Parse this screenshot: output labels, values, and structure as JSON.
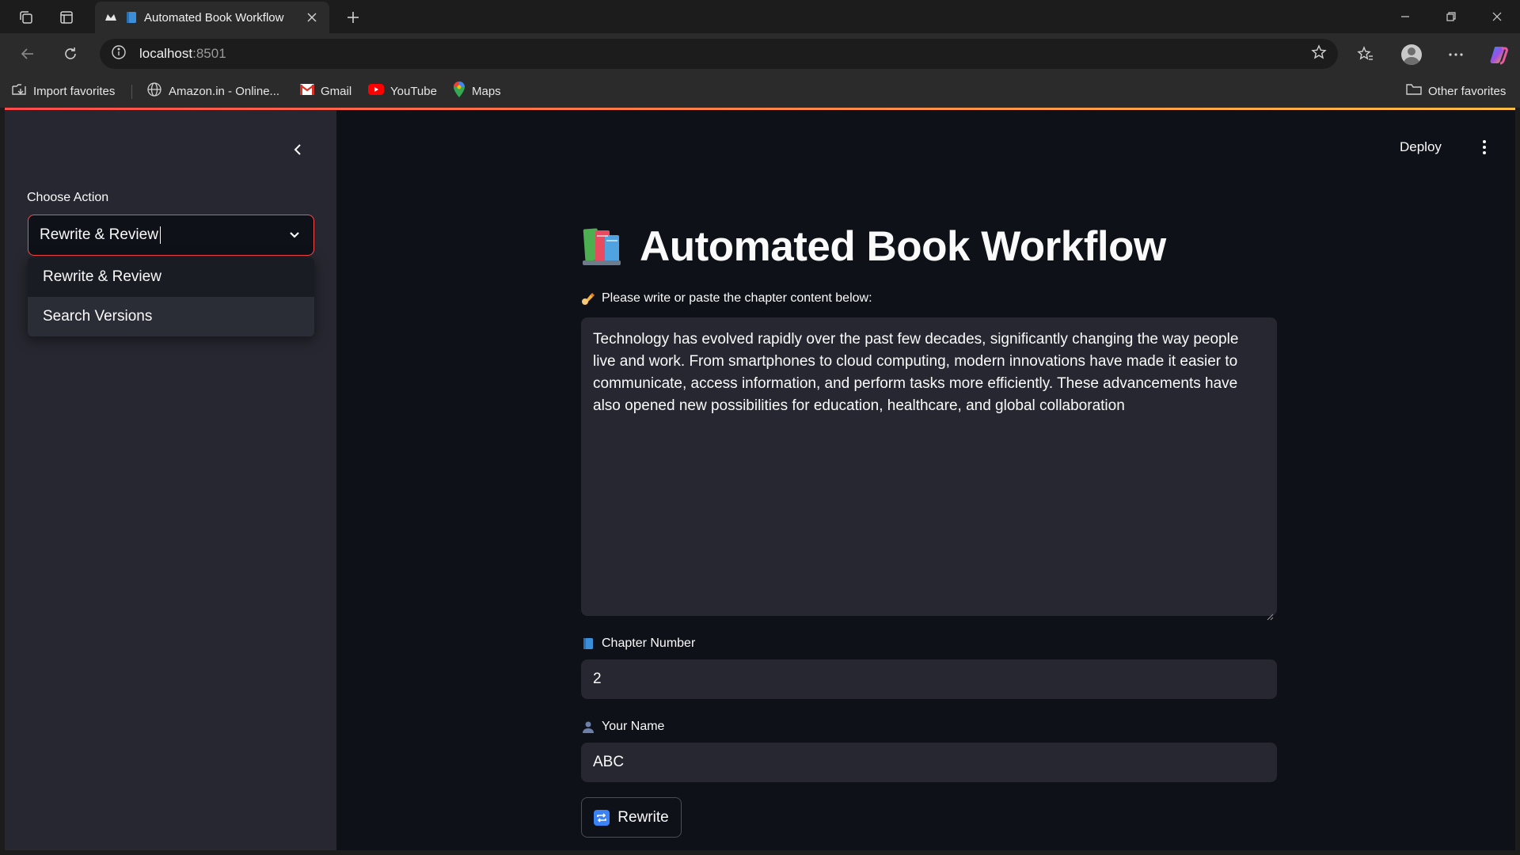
{
  "browser": {
    "tab": {
      "title": "Automated Book Workflow"
    },
    "address": {
      "host": "localhost",
      "port": ":8501"
    },
    "bookmarks": [
      {
        "label": "Import favorites",
        "icon": "import-icon"
      },
      {
        "label": "Amazon.in - Online...",
        "icon": "globe-icon"
      },
      {
        "label": "Gmail",
        "icon": "gmail-icon"
      },
      {
        "label": "YouTube",
        "icon": "youtube-icon"
      },
      {
        "label": "Maps",
        "icon": "maps-icon"
      }
    ],
    "other_favorites": "Other favorites"
  },
  "sidebar": {
    "label": "Choose Action",
    "selected": "Rewrite & Review",
    "options": [
      "Rewrite & Review",
      "Search Versions"
    ]
  },
  "header": {
    "deploy": "Deploy"
  },
  "main": {
    "title": "Automated Book Workflow",
    "content_label": "Please write or paste the chapter content below:",
    "content_value": "Technology has evolved rapidly over the past few decades, significantly changing the way people live and work. From smartphones to cloud computing, modern innovations have made it easier to communicate, access information, and perform tasks more efficiently. These advancements have also opened new possibilities for education, healthcare, and global collaboration",
    "chapter_label": "Chapter Number",
    "chapter_value": "2",
    "name_label": "Your Name",
    "name_value": "ABC",
    "rewrite_button": "Rewrite"
  },
  "colors": {
    "accent": "#ff4b4b",
    "app_bg": "#0e1117",
    "sidebar_bg": "#262730",
    "input_bg": "#262730"
  }
}
